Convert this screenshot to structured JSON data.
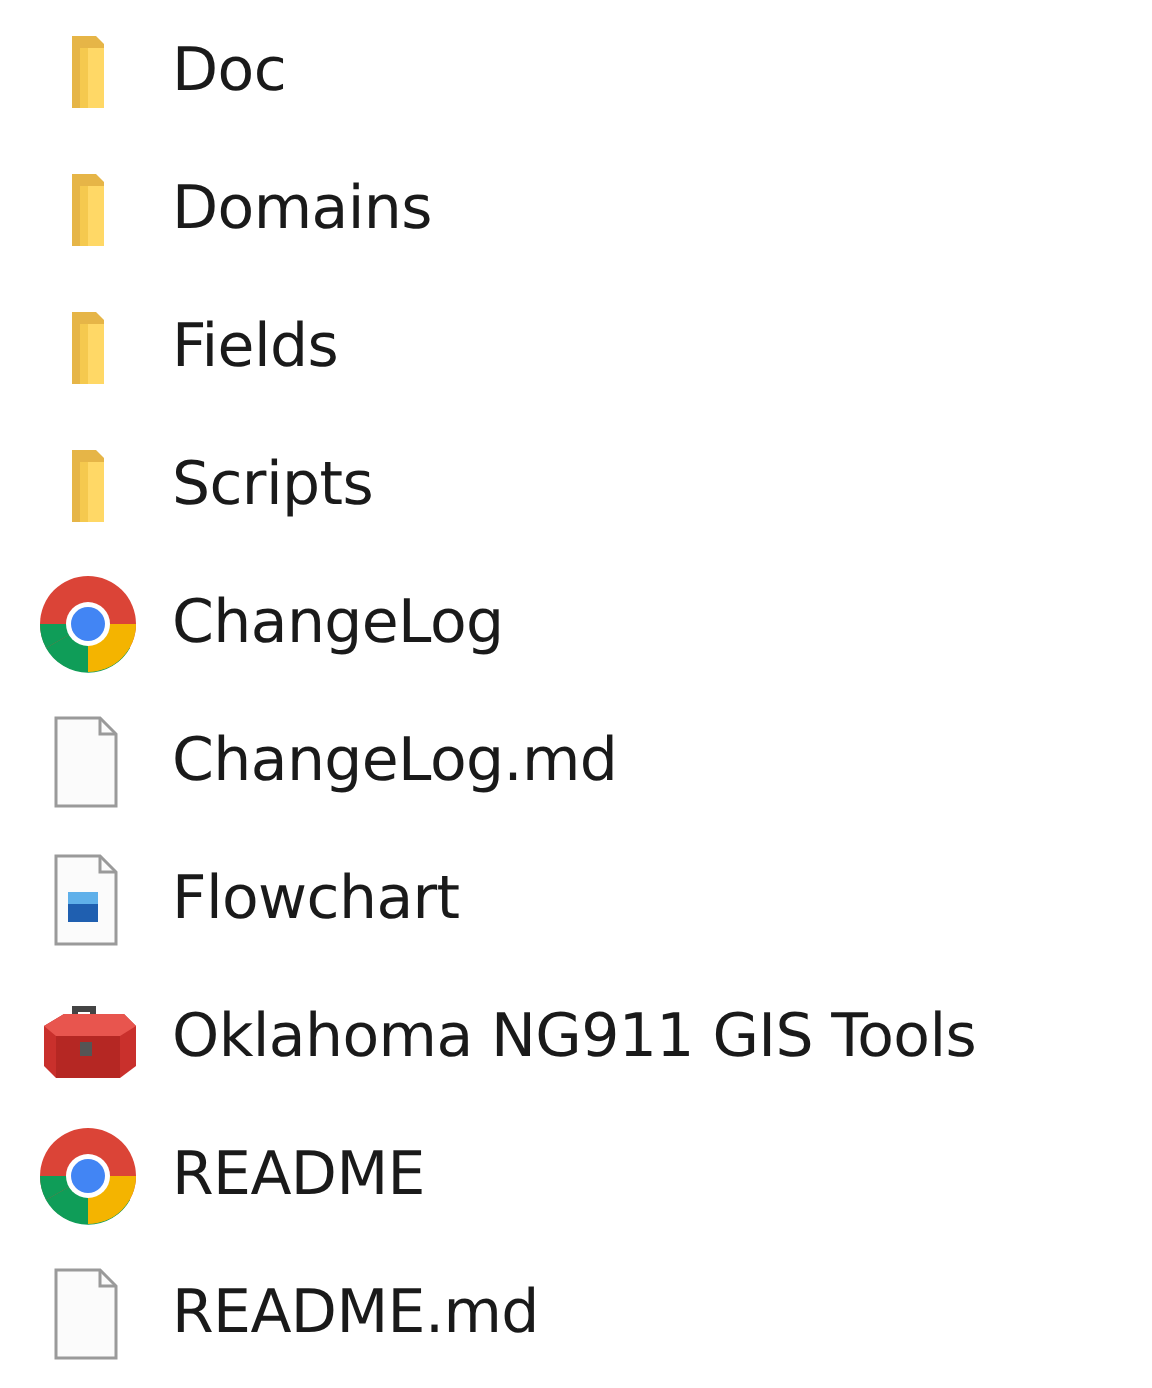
{
  "files": [
    {
      "kind": "folder",
      "name": "Doc"
    },
    {
      "kind": "folder",
      "name": "Domains"
    },
    {
      "kind": "folder",
      "name": "Fields"
    },
    {
      "kind": "folder",
      "name": "Scripts"
    },
    {
      "kind": "browser",
      "name": "ChangeLog"
    },
    {
      "kind": "document",
      "name": "ChangeLog.md"
    },
    {
      "kind": "image",
      "name": "Flowchart"
    },
    {
      "kind": "toolbox",
      "name": "Oklahoma NG911 GIS Tools"
    },
    {
      "kind": "browser",
      "name": "README"
    },
    {
      "kind": "document",
      "name": "README.md"
    }
  ]
}
